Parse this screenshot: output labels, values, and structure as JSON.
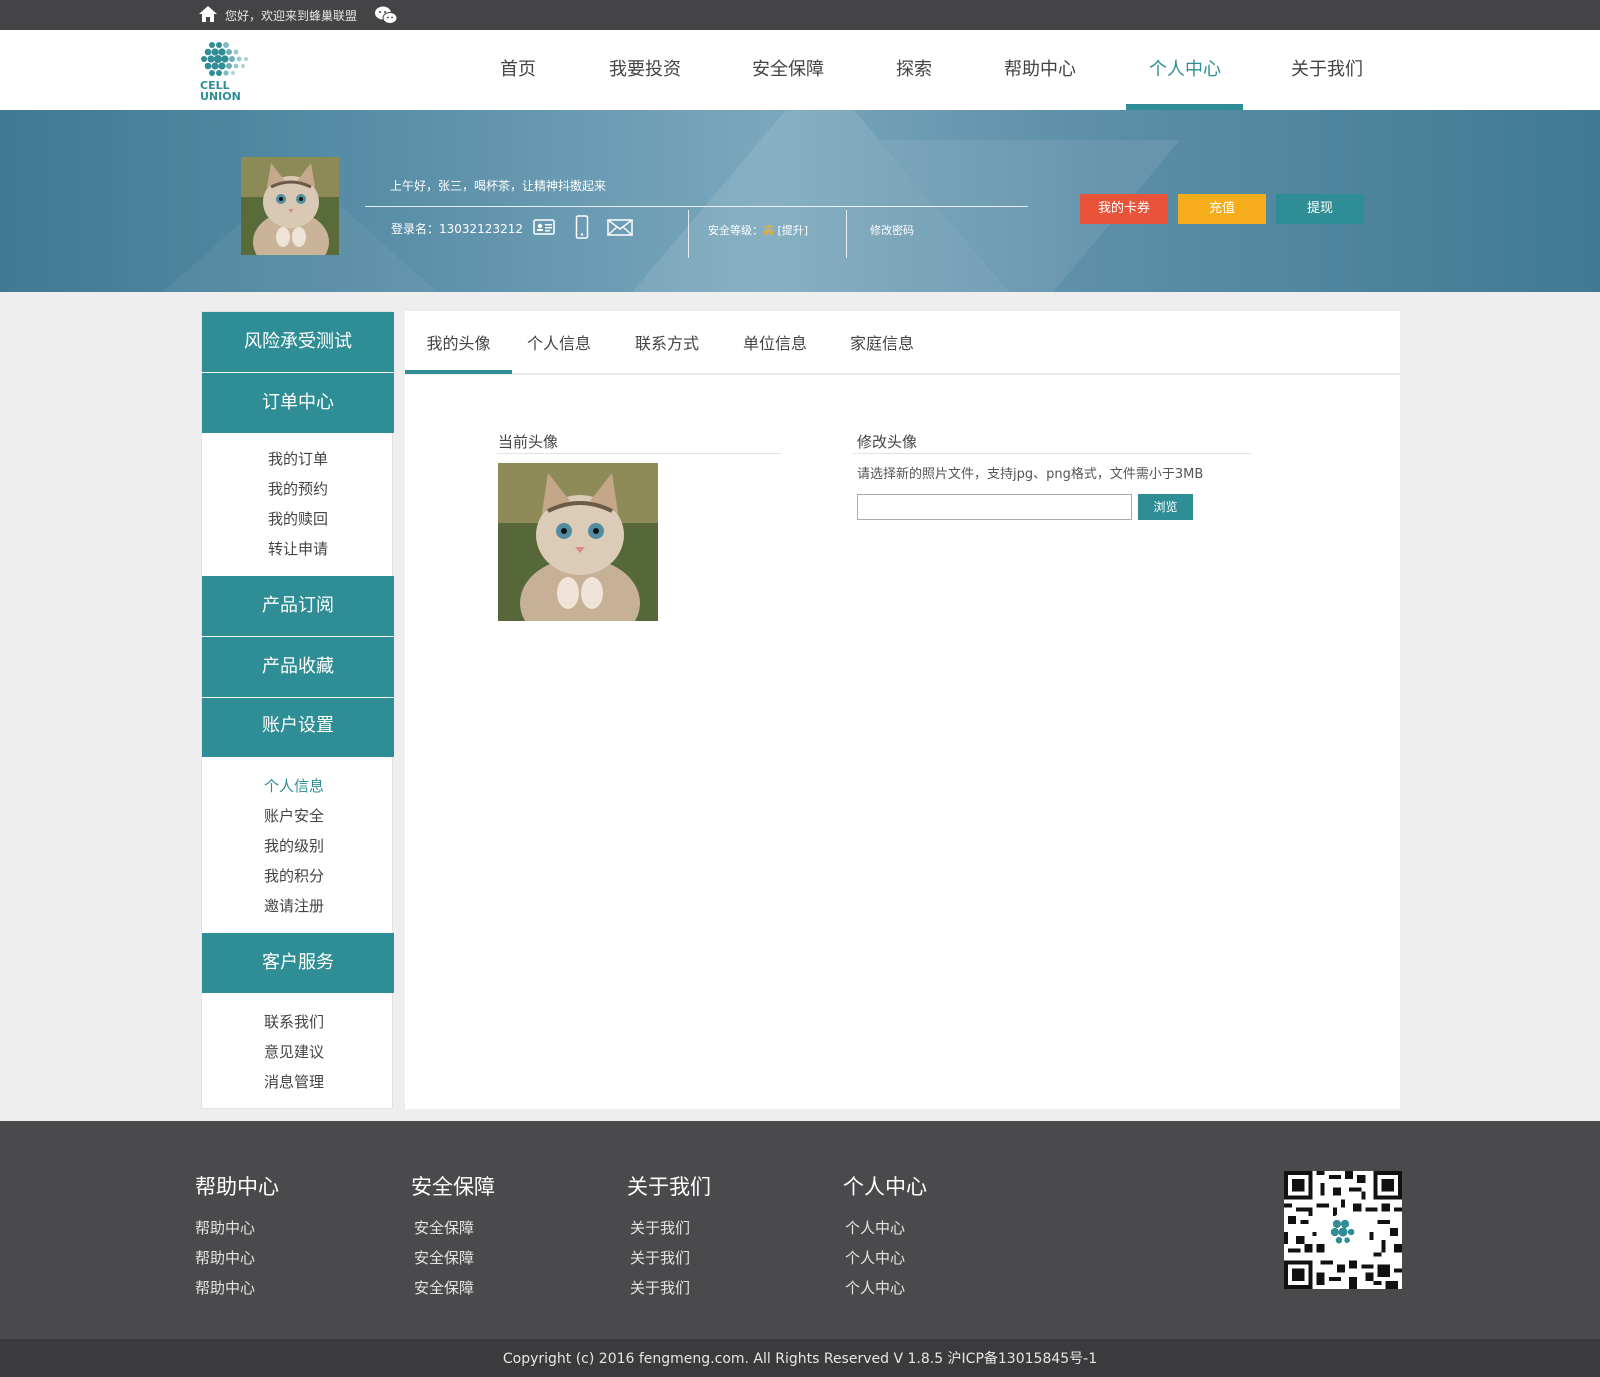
{
  "topbar": {
    "greeting": "您好，欢迎来到蜂巢联盟"
  },
  "brand": {
    "logo_text_line1": "CELL",
    "logo_text_line2": "UNION",
    "accent": "#2f8e95"
  },
  "nav": {
    "items": [
      "首页",
      "我要投资",
      "安全保障",
      "探索",
      "帮助中心",
      "个人中心",
      "关于我们"
    ],
    "active": "个人中心"
  },
  "banner": {
    "hello": "上午好，张三，喝杯茶，让精神抖擞起来",
    "login_label": "登录名：13032123212",
    "security_prefix": "安全等级：",
    "security_level": "高",
    "security_upgrade": "[提升]",
    "change_password": "修改密码",
    "btn_card": "我的卡券",
    "btn_charge": "充值",
    "btn_withdraw": "提现"
  },
  "sidebar": {
    "risk_test": "风险承受测试",
    "order_center": "订单中心",
    "order_links": [
      "我的订单",
      "我的预约",
      "我的赎回",
      "转让申请"
    ],
    "product_sub": "产品订阅",
    "product_fav": "产品收藏",
    "account_settings": "账户设置",
    "account_links": [
      "个人信息",
      "账户安全",
      "我的级别",
      "我的积分",
      "邀请注册"
    ],
    "account_active": "个人信息",
    "customer_service": "客户服务",
    "service_links": [
      "联系我们",
      "意见建议",
      "消息管理"
    ]
  },
  "main": {
    "tabs": [
      "我的头像",
      "个人信息",
      "联系方式",
      "单位信息",
      "家庭信息"
    ],
    "active_tab": "我的头像",
    "current_avatar_title": "当前头像",
    "change_avatar_title": "修改头像",
    "hint": "请选择新的照片文件，支持jpg、png格式，文件需小于3MB",
    "file_value": "",
    "browse": "浏览"
  },
  "footer": {
    "columns": [
      {
        "title": "帮助中心",
        "links": [
          "帮助中心",
          "帮助中心",
          "帮助中心"
        ]
      },
      {
        "title": "安全保障",
        "links": [
          "安全保障",
          "安全保障",
          "安全保障"
        ]
      },
      {
        "title": "关于我们",
        "links": [
          "关于我们",
          "关于我们",
          "关于我们"
        ]
      },
      {
        "title": "个人中心",
        "links": [
          "个人中心",
          "个人中心",
          "个人中心"
        ]
      }
    ],
    "copyright": "Copyright (c) 2016 fengmeng.com. All Rights Reserved V 1.8.5 沪ICP备13015845号-1"
  }
}
